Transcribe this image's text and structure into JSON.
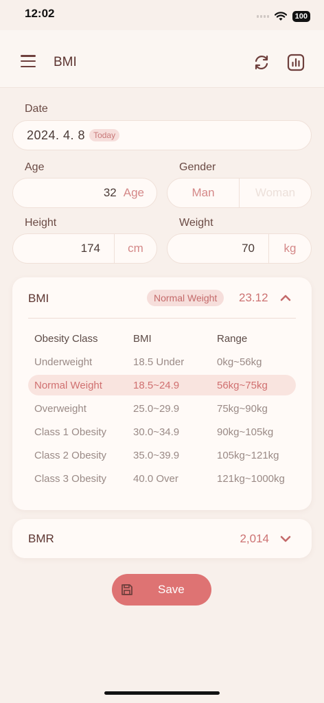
{
  "status": {
    "time": "12:02",
    "battery": "100"
  },
  "header": {
    "title": "BMI"
  },
  "form": {
    "date_label": "Date",
    "date_value": "2024. 4. 8",
    "today_badge": "Today",
    "age_label": "Age",
    "age_value": "32",
    "age_unit": "Age",
    "gender_label": "Gender",
    "gender_man": "Man",
    "gender_woman": "Woman",
    "gender_selected": "Man",
    "height_label": "Height",
    "height_value": "174",
    "height_unit": "cm",
    "weight_label": "Weight",
    "weight_value": "70",
    "weight_unit": "kg"
  },
  "bmi_card": {
    "title": "BMI",
    "status_badge": "Normal Weight",
    "value": "23.12",
    "table": {
      "headers": [
        "Obesity Class",
        "BMI",
        "Range"
      ],
      "rows": [
        [
          "Underweight",
          "18.5 Under",
          "0kg~56kg"
        ],
        [
          "Normal Weight",
          "18.5~24.9",
          "56kg~75kg"
        ],
        [
          "Overweight",
          "25.0~29.9",
          "75kg~90kg"
        ],
        [
          "Class 1 Obesity",
          "30.0~34.9",
          "90kg~105kg"
        ],
        [
          "Class 2 Obesity",
          "35.0~39.9",
          "105kg~121kg"
        ],
        [
          "Class 3 Obesity",
          "40.0 Over",
          "121kg~1000kg"
        ]
      ]
    }
  },
  "bmr_card": {
    "title": "BMR",
    "value": "2,014"
  },
  "save_button": {
    "label": "Save"
  },
  "colors": {
    "accent": "#de7373",
    "background": "#f8f0eb",
    "card": "#fffaf7"
  },
  "icons": [
    "menu-icon",
    "refresh-icon",
    "chart-icon",
    "chevron-up-icon",
    "chevron-down-icon",
    "save-icon"
  ]
}
